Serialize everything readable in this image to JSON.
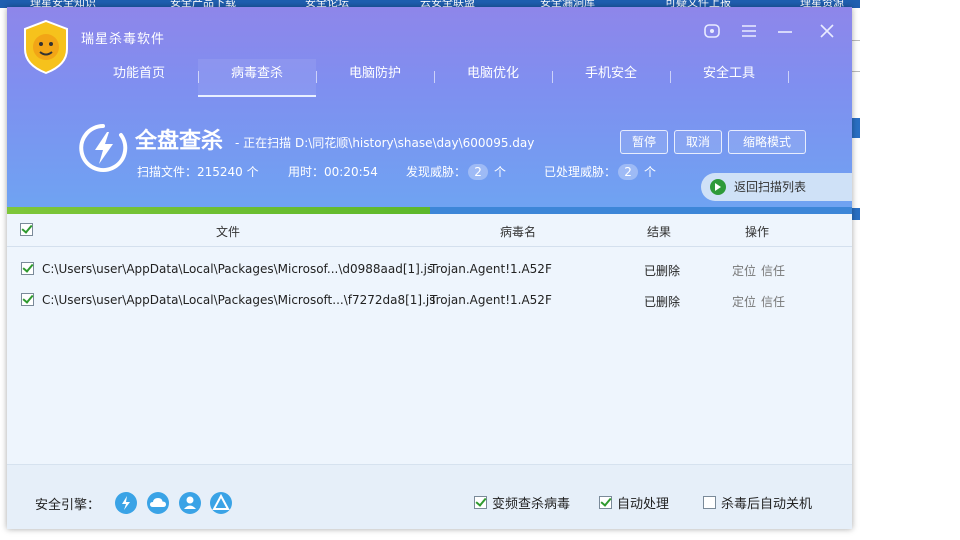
{
  "background_page": {
    "top_links": [
      "理星安全知识",
      "安全产品下载",
      "安全论坛",
      "云安全联盟",
      "安全漏洞库",
      "可疑文件上报",
      "理星资源"
    ]
  },
  "window": {
    "title": "瑞星杀毒软件",
    "controls": [
      "user-icon",
      "menu-icon",
      "minimize-icon",
      "close-icon"
    ]
  },
  "nav": {
    "items": [
      "功能首页",
      "病毒查杀",
      "电脑防护",
      "电脑优化",
      "手机安全",
      "安全工具"
    ],
    "active": "病毒查杀"
  },
  "scan": {
    "title": "全盘查杀",
    "status": "- 正在扫描 D:\\同花顺\\history\\shase\\day\\600095.day",
    "files_label": "扫描文件：215240 个",
    "time_label": "用时：00:20:54",
    "threats_label": "发现威胁：",
    "threats_count": "2",
    "threats_unit": "个",
    "handled_label": "已处理威胁：",
    "handled_count": "2",
    "handled_unit": "个",
    "progress_fraction": 0.5,
    "buttons": {
      "pause": "暂停",
      "cancel": "取消",
      "compact": "缩略模式"
    },
    "return_list": "返回扫描列表"
  },
  "table": {
    "headers": {
      "file": "文件",
      "virus": "病毒名",
      "result": "结果",
      "action": "操作"
    },
    "rows": [
      {
        "file": "C:\\Users\\user\\AppData\\Local\\Packages\\Microsof...\\d0988aad[1].js",
        "virus": "Trojan.Agent!1.A52F",
        "result": "已删除",
        "locate": "定位",
        "trust": "信任"
      },
      {
        "file": "C:\\Users\\user\\AppData\\Local\\Packages\\Microsoft...\\f7272da8[1].js",
        "virus": "Trojan.Agent!1.A52F",
        "result": "已删除",
        "locate": "定位",
        "trust": "信任"
      }
    ]
  },
  "footer": {
    "engine_label": "安全引擎：",
    "engines": [
      "lightning-engine-icon",
      "cloud-engine-icon",
      "user-engine-icon",
      "ai-engine-icon"
    ],
    "options": [
      {
        "label": "变频查杀病毒",
        "checked": true
      },
      {
        "label": "自动处理",
        "checked": true
      },
      {
        "label": "杀毒后自动关机",
        "checked": false
      }
    ]
  },
  "colors": {
    "header_top": "#8e86ea",
    "header_bottom": "#6fa3f2",
    "progress_fill": "#7ec63a",
    "check_green": "#2f9a2f"
  }
}
